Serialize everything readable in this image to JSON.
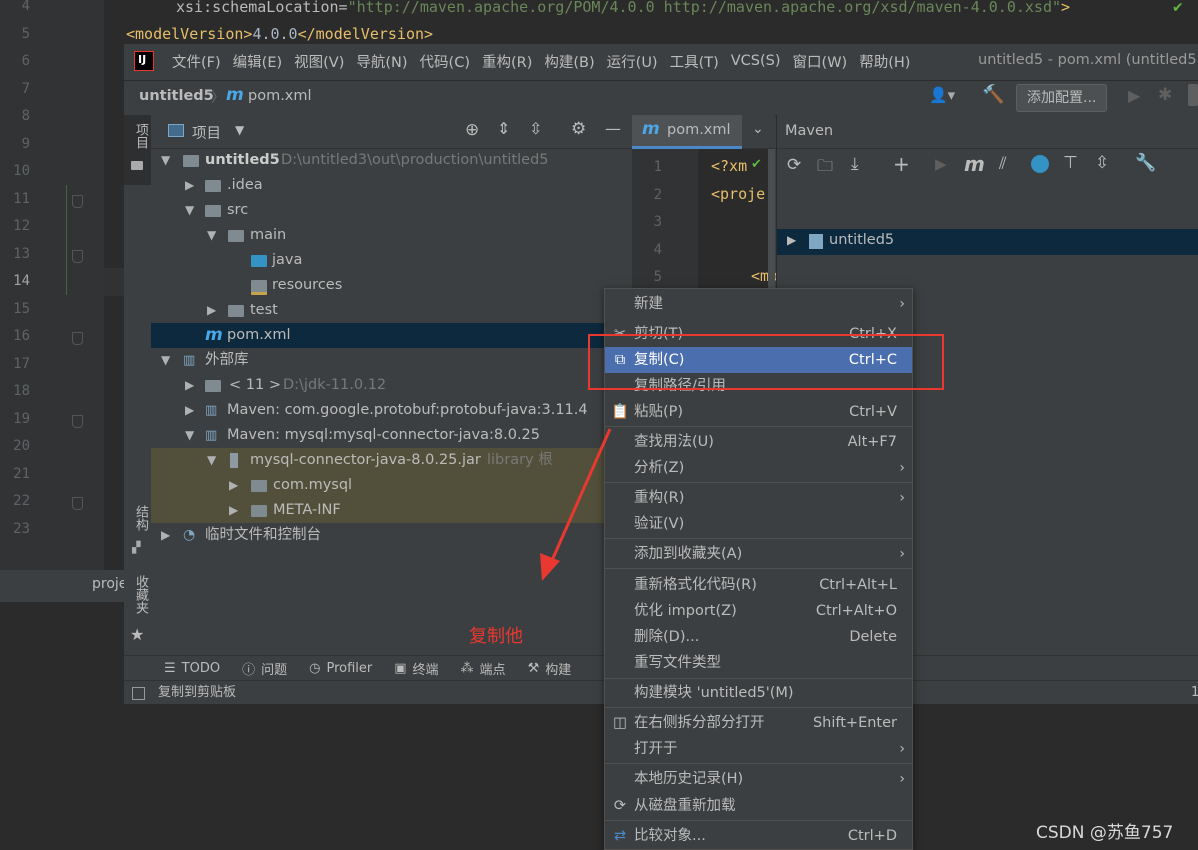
{
  "background_editor": {
    "line_numbers": [
      "4",
      "5",
      "6",
      "7",
      "8",
      "9",
      "10",
      "11",
      "12",
      "13",
      "14",
      "15",
      "16",
      "17",
      "18",
      "19",
      "20",
      "21",
      "22",
      "23"
    ],
    "current_line": "14",
    "line1_attr": "xsi:schemaLocation=",
    "line1_value": "\"http://maven.apache.org/POM/4.0.0 http://maven.apache.org/xsd/maven-4.0.0.xsd\"",
    "line1_end": ">",
    "line2_open": "<modelVersion>",
    "line2_text": "4.0.0",
    "line2_close": "</modelVersion>",
    "bottom_tab": "proje"
  },
  "menubar": {
    "items": [
      "文件(F)",
      "编辑(E)",
      "视图(V)",
      "导航(N)",
      "代码(C)",
      "重构(R)",
      "构建(B)",
      "运行(U)",
      "工具(T)",
      "VCS(S)",
      "窗口(W)",
      "帮助(H)"
    ],
    "window_title": "untitled5 - pom.xml (untitled5"
  },
  "navbar": {
    "breadcrumb_project": "untitled5",
    "breadcrumb_file": "pom.xml",
    "add_config": "添加配置..."
  },
  "side_tabs": {
    "project": "项目",
    "structure": "结构",
    "favorites": "收藏夹"
  },
  "project_panel": {
    "title": "项目",
    "tree": [
      {
        "label": "untitled5",
        "extra": "D:\\untitled3\\out\\production\\untitled5",
        "bold": true
      },
      {
        "label": ".idea"
      },
      {
        "label": "src"
      },
      {
        "label": "main"
      },
      {
        "label": "java"
      },
      {
        "label": "resources"
      },
      {
        "label": "test"
      },
      {
        "label": "pom.xml"
      },
      {
        "label": "外部库"
      },
      {
        "label": "< 11 >",
        "extra": "D:\\jdk-11.0.12"
      },
      {
        "label": "Maven: com.google.protobuf:protobuf-java:3.11.4"
      },
      {
        "label": "Maven: mysql:mysql-connector-java:8.0.25"
      },
      {
        "label": "mysql-connector-java-8.0.25.jar",
        "extra": "library 根"
      },
      {
        "label": "com.mysql"
      },
      {
        "label": "META-INF"
      },
      {
        "label": "临时文件和控制台"
      }
    ]
  },
  "editor": {
    "tab": "pom.xml",
    "lines": [
      "1",
      "2",
      "3",
      "4",
      "5"
    ],
    "code1": "<?xm",
    "code2": "<proje",
    "code5": "<mo"
  },
  "maven": {
    "title": "Maven",
    "project": "untitled5"
  },
  "annotation": {
    "text": "复制他",
    "color": "#e8382f"
  },
  "bottom_tools": [
    "TODO",
    "问题",
    "Profiler",
    "终端",
    "端点",
    "构建"
  ],
  "status": {
    "text": "复制到剪贴板",
    "right": "1"
  },
  "context_menu": {
    "items": [
      {
        "label": "新建",
        "shortcut": "",
        "submenu": true
      },
      {
        "label": "剪切(T)",
        "shortcut": "Ctrl+X",
        "submenu": false
      },
      {
        "label": "复制(C)",
        "shortcut": "Ctrl+C",
        "submenu": false
      },
      {
        "label": "复制路径/引用...",
        "shortcut": "",
        "submenu": false
      },
      {
        "label": "粘贴(P)",
        "shortcut": "Ctrl+V",
        "submenu": false
      },
      {
        "label": "查找用法(U)",
        "shortcut": "Alt+F7",
        "submenu": false
      },
      {
        "label": "分析(Z)",
        "shortcut": "",
        "submenu": true
      },
      {
        "label": "重构(R)",
        "shortcut": "",
        "submenu": true
      },
      {
        "label": "验证(V)",
        "shortcut": "",
        "submenu": false
      },
      {
        "label": "添加到收藏夹(A)",
        "shortcut": "",
        "submenu": true
      },
      {
        "label": "重新格式化代码(R)",
        "shortcut": "Ctrl+Alt+L",
        "submenu": false
      },
      {
        "label": "优化 import(Z)",
        "shortcut": "Ctrl+Alt+O",
        "submenu": false
      },
      {
        "label": "删除(D)...",
        "shortcut": "Delete",
        "submenu": false
      },
      {
        "label": "重写文件类型",
        "shortcut": "",
        "submenu": false
      },
      {
        "label": "构建模块 'untitled5'(M)",
        "shortcut": "",
        "submenu": false
      },
      {
        "label": "在右侧拆分部分打开",
        "shortcut": "Shift+Enter",
        "submenu": false
      },
      {
        "label": "打开于",
        "shortcut": "",
        "submenu": true
      },
      {
        "label": "本地历史记录(H)",
        "shortcut": "",
        "submenu": true
      },
      {
        "label": "从磁盘重新加载",
        "shortcut": "",
        "submenu": false
      },
      {
        "label": "比较对象...",
        "shortcut": "Ctrl+D",
        "submenu": false
      }
    ]
  },
  "watermark": "CSDN @苏鱼757",
  "colors": {
    "selection": "#4b6eaf",
    "highlight_box": "#e8382f",
    "tree_selection": "#0d293e"
  }
}
